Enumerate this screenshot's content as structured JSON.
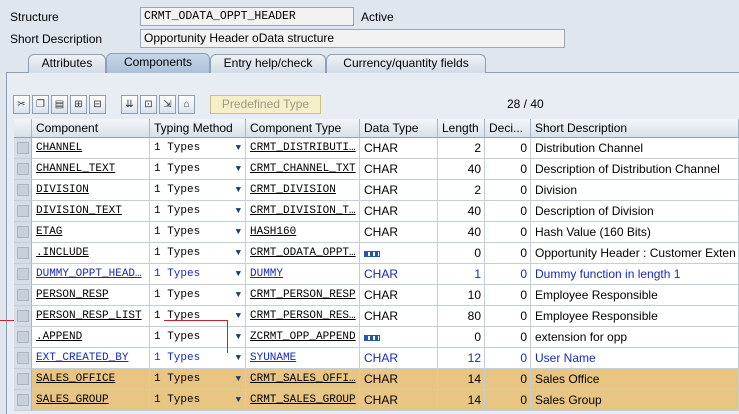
{
  "header": {
    "structure_label": "Structure",
    "structure_value": "CRMT_ODATA_OPPT_HEADER",
    "status": "Active",
    "short_desc_label": "Short Description",
    "short_desc_value": "Opportunity Header oData structure"
  },
  "tabs": [
    {
      "label": "Attributes",
      "active": false
    },
    {
      "label": "Components",
      "active": true
    },
    {
      "label": "Entry help/check",
      "active": false
    },
    {
      "label": "Currency/quantity fields",
      "active": false
    }
  ],
  "toolbar": {
    "buttons": [
      "cut-icon",
      "copy-icon",
      "paste-icon",
      "insert-row-icon",
      "delete-row-icon",
      "find-icon",
      "find-next-icon",
      "insert-table-icon",
      "move-up-icon"
    ],
    "predefined_type_label": "Predefined Type",
    "counter": "28 / 40"
  },
  "columns": {
    "component": "Component",
    "typing_method": "Typing Method",
    "component_type": "Component Type",
    "data_type": "Data Type",
    "length": "Length",
    "decimals": "Deci...",
    "short_description": "Short Description"
  },
  "rows": [
    {
      "component": "CHANNEL",
      "typing": "1 Types",
      "comp_type": "CRMT_DISTRIBUTI…",
      "data_type": "CHAR",
      "length": "2",
      "decimals": "0",
      "desc": "Distribution Channel",
      "blue": false,
      "hl": false,
      "dt_icon": false
    },
    {
      "component": "CHANNEL_TEXT",
      "typing": "1 Types",
      "comp_type": "CRMT_CHANNEL_TXT",
      "data_type": "CHAR",
      "length": "40",
      "decimals": "0",
      "desc": "Description of Distribution Channel",
      "blue": false,
      "hl": false,
      "dt_icon": false
    },
    {
      "component": "DIVISION",
      "typing": "1 Types",
      "comp_type": "CRMT_DIVISION",
      "data_type": "CHAR",
      "length": "2",
      "decimals": "0",
      "desc": "Division",
      "blue": false,
      "hl": false,
      "dt_icon": false
    },
    {
      "component": "DIVISION_TEXT",
      "typing": "1 Types",
      "comp_type": "CRMT_DIVISION_T…",
      "data_type": "CHAR",
      "length": "40",
      "decimals": "0",
      "desc": "Description of Division",
      "blue": false,
      "hl": false,
      "dt_icon": false
    },
    {
      "component": "ETAG",
      "typing": "1 Types",
      "comp_type": "HASH160",
      "data_type": "CHAR",
      "length": "40",
      "decimals": "0",
      "desc": "Hash Value (160 Bits)",
      "blue": false,
      "hl": false,
      "dt_icon": false
    },
    {
      "component": ".INCLUDE",
      "typing": "1 Types",
      "comp_type": "CRMT_ODATA_OPPT…",
      "data_type": "",
      "length": "0",
      "decimals": "0",
      "desc": "Opportunity Header : Customer Exten",
      "blue": false,
      "hl": false,
      "dt_icon": true
    },
    {
      "component": "DUMMY_OPPT_HEAD…",
      "typing": "1 Types",
      "comp_type": "DUMMY",
      "data_type": "CHAR",
      "length": "1",
      "decimals": "0",
      "desc": "Dummy function in length 1",
      "blue": true,
      "hl": false,
      "dt_icon": false
    },
    {
      "component": "PERSON_RESP",
      "typing": "1 Types",
      "comp_type": "CRMT_PERSON_RESP",
      "data_type": "CHAR",
      "length": "10",
      "decimals": "0",
      "desc": "Employee Responsible",
      "blue": false,
      "hl": false,
      "dt_icon": false
    },
    {
      "component": "PERSON_RESP_LIST",
      "typing": "1 Types",
      "comp_type": "CRMT_PERSON_RES…",
      "data_type": "CHAR",
      "length": "80",
      "decimals": "0",
      "desc": "Employee Responsible",
      "blue": false,
      "hl": false,
      "dt_icon": false
    },
    {
      "component": ".APPEND",
      "typing": "1 Types",
      "comp_type": "ZCRMT_OPP_APPEND",
      "data_type": "",
      "length": "0",
      "decimals": "0",
      "desc": "extension for opp",
      "blue": false,
      "hl": false,
      "dt_icon": true
    },
    {
      "component": "EXT_CREATED_BY",
      "typing": "1 Types",
      "comp_type": "SYUNAME",
      "data_type": "CHAR",
      "length": "12",
      "decimals": "0",
      "desc": "User Name",
      "blue": true,
      "hl": false,
      "dt_icon": false
    },
    {
      "component": "SALES_OFFICE",
      "typing": "1 Types",
      "comp_type": "CRMT_SALES_OFFI…",
      "data_type": "CHAR",
      "length": "14",
      "decimals": "0",
      "desc": "Sales Office",
      "blue": false,
      "hl": true,
      "dt_icon": false
    },
    {
      "component": "SALES_GROUP",
      "typing": "1 Types",
      "comp_type": "CRMT_SALES_GROUP",
      "data_type": "CHAR",
      "length": "14",
      "decimals": "0",
      "desc": "Sales Group",
      "blue": false,
      "hl": true,
      "dt_icon": false
    }
  ]
}
